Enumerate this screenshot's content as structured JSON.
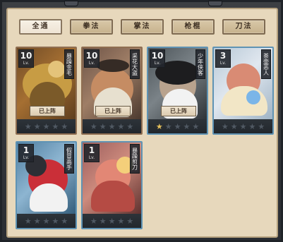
{
  "tabs": [
    {
      "label": "全通",
      "active": true
    },
    {
      "label": "拳法",
      "active": false
    },
    {
      "label": "掌法",
      "active": false
    },
    {
      "label": "枪棍",
      "active": false
    },
    {
      "label": "刀法",
      "active": false
    }
  ],
  "cards": [
    {
      "level": "10",
      "level_label": "Lv.",
      "name": "暴躁金毛",
      "deploy_label": "已上阵",
      "stars_filled": 0,
      "stars_total": 5,
      "border_color": "#4e5968"
    },
    {
      "level": "10",
      "level_label": "Lv.",
      "name": "采花大盗",
      "deploy_label": "已上阵",
      "stars_filled": 0,
      "stars_total": 5,
      "border_color": "#8f6e51"
    },
    {
      "level": "10",
      "level_label": "Lv.",
      "name": "少年侠客",
      "deploy_label": "已上阵",
      "stars_filled": 1,
      "stars_total": 5,
      "border_color": "#5f93b4"
    },
    {
      "level": "3",
      "level_label": "Lv.",
      "name": "茶壶恶人",
      "deploy_label": "",
      "stars_filled": 0,
      "stars_total": 5,
      "border_color": "#5f93b4"
    },
    {
      "level": "1",
      "level_label": "Lv.",
      "name": "假冒高手",
      "deploy_label": "",
      "stars_filled": 0,
      "stars_total": 5,
      "border_color": "#5f93b4"
    },
    {
      "level": "1",
      "level_label": "Lv.",
      "name": "暴躁剪刀",
      "deploy_label": "",
      "stars_filled": 0,
      "stars_total": 5,
      "border_color": "#5f93b4"
    }
  ]
}
